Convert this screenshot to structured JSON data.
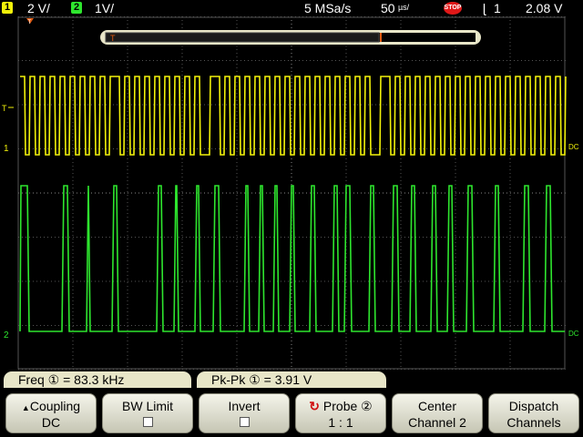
{
  "status": {
    "ch1_num": "1",
    "ch1_scale": "2 V/",
    "ch2_num": "2",
    "ch2_scale": "1V/",
    "sample_rate": "5 MSa/s",
    "timebase": "50",
    "timebase_unit": "µs/",
    "run_state": "STOP",
    "trigger_icon": "rising-edge-trigger-icon",
    "trigger_source": "1",
    "trigger_level": "2.08 V"
  },
  "colors": {
    "ch1": "#f2f20a",
    "ch2": "#2ee62e",
    "grid": "#666666",
    "trigger_marker": "#e05a10",
    "softkey_bg": "#e8e6c8"
  },
  "scope": {
    "trigger_label": "T",
    "trigger_pos_label": "T",
    "ch1_ground": "1",
    "ch2_ground": "2",
    "coupling_right": "DC"
  },
  "measurements": {
    "freq": "Freq ① = 83.3 kHz",
    "pkpk": "Pk-Pk ① = 3.91 V"
  },
  "softkeys": [
    {
      "name": "coupling",
      "line1": "Coupling",
      "line2": "DC",
      "icon": "up-arrow-icon"
    },
    {
      "name": "bw-limit",
      "line1": "BW Limit",
      "line2": "",
      "checkbox": true
    },
    {
      "name": "invert",
      "line1": "Invert",
      "line2": "",
      "checkbox": true
    },
    {
      "name": "probe",
      "line1": "Probe ②",
      "line2": "1 : 1",
      "icon": "rotate-knob-icon"
    },
    {
      "name": "center-channel-2",
      "line1": "Center",
      "line2": "Channel 2"
    },
    {
      "name": "dispatch-channels",
      "line1": "Dispatch",
      "line2": "Channels"
    }
  ]
}
